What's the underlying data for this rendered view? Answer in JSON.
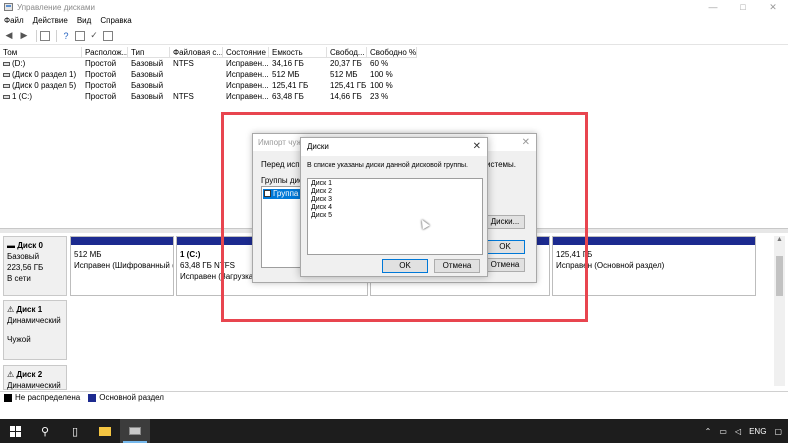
{
  "window": {
    "title": "Управление дисками",
    "controls": {
      "minimize": "—",
      "maximize": "□",
      "close": "✕"
    }
  },
  "menu": [
    "Файл",
    "Действие",
    "Вид",
    "Справка"
  ],
  "volume_table": {
    "headers": [
      "Том",
      "Располож...",
      "Тип",
      "Файловая с...",
      "Состояние",
      "Емкость",
      "Свобод...",
      "Свободно %"
    ],
    "rows": [
      [
        "(D:)",
        "Простой",
        "Базовый",
        "NTFS",
        "Исправен...",
        "34,16 ГБ",
        "20,37 ГБ",
        "60 %"
      ],
      [
        "(Диск 0 раздел 1)",
        "Простой",
        "Базовый",
        "",
        "Исправен...",
        "512 МБ",
        "512 МБ",
        "100 %"
      ],
      [
        "(Диск 0 раздел 5)",
        "Простой",
        "Базовый",
        "",
        "Исправен...",
        "125,41 ГБ",
        "125,41 ГБ",
        "100 %"
      ],
      [
        "1 (C:)",
        "Простой",
        "Базовый",
        "NTFS",
        "Исправен...",
        "63,48 ГБ",
        "14,66 ГБ",
        "23 %"
      ]
    ]
  },
  "disks": [
    {
      "name": "Диск 0",
      "type": "Базовый",
      "size": "223,56 ГБ",
      "status": "В сети",
      "partitions": [
        {
          "title": "",
          "size": "512 МБ",
          "status": "Исправен (Шифрованный (EF"
        },
        {
          "title": "1 (C:)",
          "size": "63,48 ГБ NTFS",
          "status": "Исправен (Загрузка, Файл по"
        },
        {
          "title": "",
          "size": "",
          "status": ""
        },
        {
          "title": "",
          "size": "125,41 ГБ",
          "status": "Исправен (Основной раздел)"
        }
      ]
    },
    {
      "name": "Диск 1",
      "type": "Динамический",
      "size": "",
      "status": "Чужой"
    },
    {
      "name": "Диск 2",
      "type": "Динамический",
      "size": "",
      "status": ""
    }
  ],
  "legend": [
    {
      "label": "Не распределена",
      "color": "#000000"
    },
    {
      "label": "Основной раздел",
      "color": "#1c2a8f"
    }
  ],
  "dialog_import": {
    "title": "Импорт чуж",
    "text_left": "Перед испол",
    "text_right": "истемы.",
    "groups_label": "Группы диск",
    "group_item": "Группа ч",
    "disks_button": "Диски...",
    "ok_button": "OK",
    "cancel_button": "Отмена"
  },
  "dialog_disks": {
    "title": "Диски",
    "close": "✕",
    "description": "В списке указаны диски данной дисковой группы.",
    "items": [
      "Диск 1",
      "Диск 2",
      "Диск 3",
      "Диск 4",
      "Диск 5"
    ],
    "ok_button": "OK",
    "cancel_button": "Отмена"
  },
  "taskbar": {
    "language": "ENG"
  },
  "colors": {
    "accent": "#0078d7",
    "highlight": "#e8454f",
    "partition_bar": "#1c2a8f"
  }
}
